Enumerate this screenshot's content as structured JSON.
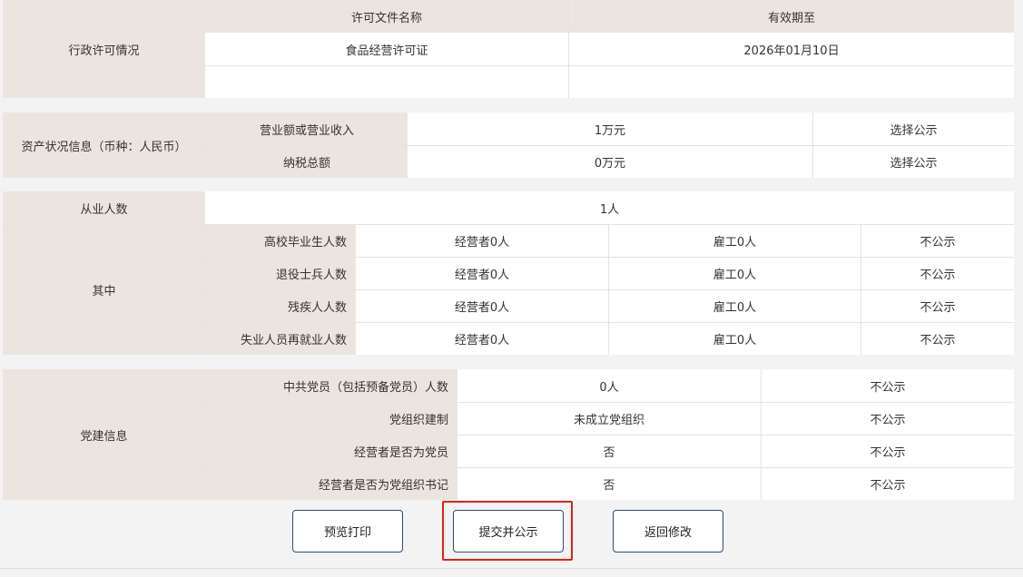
{
  "license": {
    "section_label": "行政许可情况",
    "col_name": "许可文件名称",
    "col_valid": "有效期至",
    "rows": [
      {
        "name": "食品经营许可证",
        "valid_until": "2026年01月10日"
      },
      {
        "name": "",
        "valid_until": ""
      }
    ]
  },
  "assets": {
    "section_label": "资产状况信息（币种：人民币）",
    "rows": [
      {
        "label": "营业额或营业收入",
        "value": "1万元",
        "disclosure": "选择公示"
      },
      {
        "label": "纳税总额",
        "value": "0万元",
        "disclosure": "选择公示"
      }
    ]
  },
  "employees": {
    "label": "从业人数",
    "value": "1人",
    "sub_label": "其中",
    "rows": [
      {
        "label": "高校毕业生人数",
        "operator": "经营者0人",
        "employee": "雇工0人",
        "disclosure": "不公示"
      },
      {
        "label": "退役士兵人数",
        "operator": "经营者0人",
        "employee": "雇工0人",
        "disclosure": "不公示"
      },
      {
        "label": "残疾人人数",
        "operator": "经营者0人",
        "employee": "雇工0人",
        "disclosure": "不公示"
      },
      {
        "label": "失业人员再就业人数",
        "operator": "经营者0人",
        "employee": "雇工0人",
        "disclosure": "不公示"
      }
    ]
  },
  "party": {
    "section_label": "党建信息",
    "rows": [
      {
        "label": "中共党员（包括预备党员）人数",
        "value": "0人",
        "disclosure": "不公示"
      },
      {
        "label": "党组织建制",
        "value": "未成立党组织",
        "disclosure": "不公示"
      },
      {
        "label": "经营者是否为党员",
        "value": "否",
        "disclosure": "不公示"
      },
      {
        "label": "经营者是否为党组织书记",
        "value": "否",
        "disclosure": "不公示"
      }
    ]
  },
  "actions": {
    "preview_print": "预览打印",
    "submit_publish": "提交并公示",
    "back_edit": "返回修改"
  }
}
